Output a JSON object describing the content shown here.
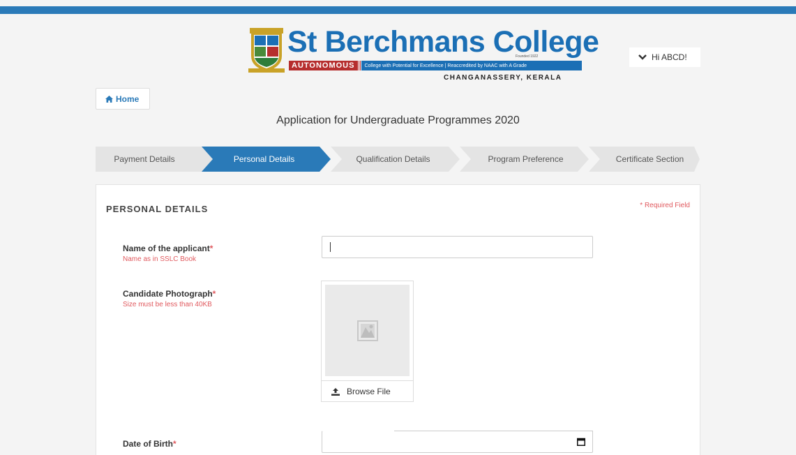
{
  "logo": {
    "title": "St Berchmans College",
    "founded": "Founded 1922",
    "autonomous": "AUTONOMOUS",
    "tagline": "College with Potential for Excellence | Reaccredited by NAAC with A Grade",
    "location": "CHANGANASSERY, KERALA"
  },
  "user_menu": {
    "greeting": "Hi ABCD!",
    "icon": "chevron-down-icon"
  },
  "home_button": {
    "label": "Home",
    "icon": "home-icon"
  },
  "page_title": "Application for Undergraduate Programmes 2020",
  "steps": [
    {
      "label": "Payment Details",
      "active": false
    },
    {
      "label": "Personal Details",
      "active": true
    },
    {
      "label": "Qualification Details",
      "active": false
    },
    {
      "label": "Program Preference",
      "active": false
    },
    {
      "label": "Certificate Section",
      "active": false
    }
  ],
  "panel": {
    "title": "PERSONAL DETAILS",
    "required_note": "* Required Field",
    "fields": {
      "name": {
        "label": "Name of the applicant",
        "star": "*",
        "hint": "Name as in SSLC Book",
        "value": ""
      },
      "photo": {
        "label": "Candidate Photograph",
        "star": "*",
        "hint": "Size must be less than 40KB",
        "browse_label": "Browse File",
        "icon": "image-placeholder-icon"
      },
      "dob": {
        "label": "Date of Birth",
        "star": "*",
        "value": "",
        "icon": "calendar-icon"
      }
    }
  },
  "colors": {
    "primary": "#2a7ab8",
    "required": "#e0595e",
    "step_inactive": "#e4e4e4",
    "step_active": "#2a7ab8",
    "logo_blue": "#1b6fb5",
    "logo_red": "#b62e2e"
  }
}
